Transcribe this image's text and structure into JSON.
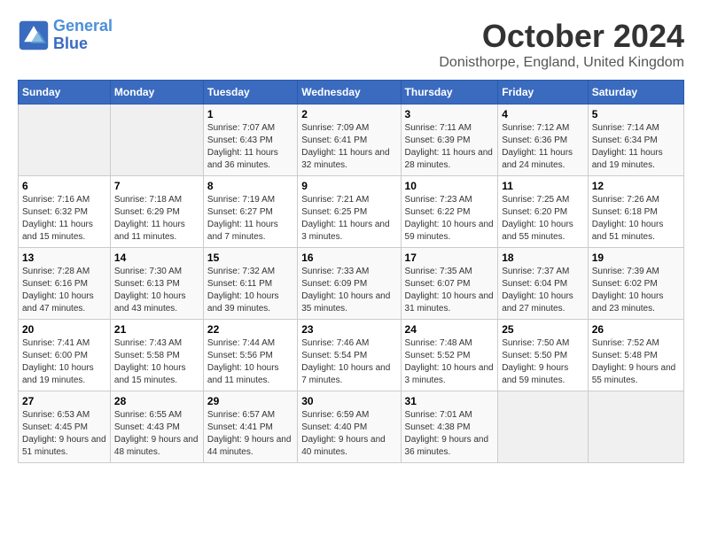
{
  "logo": {
    "line1": "General",
    "line2": "Blue"
  },
  "title": "October 2024",
  "location": "Donisthorpe, England, United Kingdom",
  "header_days": [
    "Sunday",
    "Monday",
    "Tuesday",
    "Wednesday",
    "Thursday",
    "Friday",
    "Saturday"
  ],
  "weeks": [
    [
      {
        "day": "",
        "info": ""
      },
      {
        "day": "",
        "info": ""
      },
      {
        "day": "1",
        "info": "Sunrise: 7:07 AM\nSunset: 6:43 PM\nDaylight: 11 hours and 36 minutes."
      },
      {
        "day": "2",
        "info": "Sunrise: 7:09 AM\nSunset: 6:41 PM\nDaylight: 11 hours and 32 minutes."
      },
      {
        "day": "3",
        "info": "Sunrise: 7:11 AM\nSunset: 6:39 PM\nDaylight: 11 hours and 28 minutes."
      },
      {
        "day": "4",
        "info": "Sunrise: 7:12 AM\nSunset: 6:36 PM\nDaylight: 11 hours and 24 minutes."
      },
      {
        "day": "5",
        "info": "Sunrise: 7:14 AM\nSunset: 6:34 PM\nDaylight: 11 hours and 19 minutes."
      }
    ],
    [
      {
        "day": "6",
        "info": "Sunrise: 7:16 AM\nSunset: 6:32 PM\nDaylight: 11 hours and 15 minutes."
      },
      {
        "day": "7",
        "info": "Sunrise: 7:18 AM\nSunset: 6:29 PM\nDaylight: 11 hours and 11 minutes."
      },
      {
        "day": "8",
        "info": "Sunrise: 7:19 AM\nSunset: 6:27 PM\nDaylight: 11 hours and 7 minutes."
      },
      {
        "day": "9",
        "info": "Sunrise: 7:21 AM\nSunset: 6:25 PM\nDaylight: 11 hours and 3 minutes."
      },
      {
        "day": "10",
        "info": "Sunrise: 7:23 AM\nSunset: 6:22 PM\nDaylight: 10 hours and 59 minutes."
      },
      {
        "day": "11",
        "info": "Sunrise: 7:25 AM\nSunset: 6:20 PM\nDaylight: 10 hours and 55 minutes."
      },
      {
        "day": "12",
        "info": "Sunrise: 7:26 AM\nSunset: 6:18 PM\nDaylight: 10 hours and 51 minutes."
      }
    ],
    [
      {
        "day": "13",
        "info": "Sunrise: 7:28 AM\nSunset: 6:16 PM\nDaylight: 10 hours and 47 minutes."
      },
      {
        "day": "14",
        "info": "Sunrise: 7:30 AM\nSunset: 6:13 PM\nDaylight: 10 hours and 43 minutes."
      },
      {
        "day": "15",
        "info": "Sunrise: 7:32 AM\nSunset: 6:11 PM\nDaylight: 10 hours and 39 minutes."
      },
      {
        "day": "16",
        "info": "Sunrise: 7:33 AM\nSunset: 6:09 PM\nDaylight: 10 hours and 35 minutes."
      },
      {
        "day": "17",
        "info": "Sunrise: 7:35 AM\nSunset: 6:07 PM\nDaylight: 10 hours and 31 minutes."
      },
      {
        "day": "18",
        "info": "Sunrise: 7:37 AM\nSunset: 6:04 PM\nDaylight: 10 hours and 27 minutes."
      },
      {
        "day": "19",
        "info": "Sunrise: 7:39 AM\nSunset: 6:02 PM\nDaylight: 10 hours and 23 minutes."
      }
    ],
    [
      {
        "day": "20",
        "info": "Sunrise: 7:41 AM\nSunset: 6:00 PM\nDaylight: 10 hours and 19 minutes."
      },
      {
        "day": "21",
        "info": "Sunrise: 7:43 AM\nSunset: 5:58 PM\nDaylight: 10 hours and 15 minutes."
      },
      {
        "day": "22",
        "info": "Sunrise: 7:44 AM\nSunset: 5:56 PM\nDaylight: 10 hours and 11 minutes."
      },
      {
        "day": "23",
        "info": "Sunrise: 7:46 AM\nSunset: 5:54 PM\nDaylight: 10 hours and 7 minutes."
      },
      {
        "day": "24",
        "info": "Sunrise: 7:48 AM\nSunset: 5:52 PM\nDaylight: 10 hours and 3 minutes."
      },
      {
        "day": "25",
        "info": "Sunrise: 7:50 AM\nSunset: 5:50 PM\nDaylight: 9 hours and 59 minutes."
      },
      {
        "day": "26",
        "info": "Sunrise: 7:52 AM\nSunset: 5:48 PM\nDaylight: 9 hours and 55 minutes."
      }
    ],
    [
      {
        "day": "27",
        "info": "Sunrise: 6:53 AM\nSunset: 4:45 PM\nDaylight: 9 hours and 51 minutes."
      },
      {
        "day": "28",
        "info": "Sunrise: 6:55 AM\nSunset: 4:43 PM\nDaylight: 9 hours and 48 minutes."
      },
      {
        "day": "29",
        "info": "Sunrise: 6:57 AM\nSunset: 4:41 PM\nDaylight: 9 hours and 44 minutes."
      },
      {
        "day": "30",
        "info": "Sunrise: 6:59 AM\nSunset: 4:40 PM\nDaylight: 9 hours and 40 minutes."
      },
      {
        "day": "31",
        "info": "Sunrise: 7:01 AM\nSunset: 4:38 PM\nDaylight: 9 hours and 36 minutes."
      },
      {
        "day": "",
        "info": ""
      },
      {
        "day": "",
        "info": ""
      }
    ]
  ]
}
